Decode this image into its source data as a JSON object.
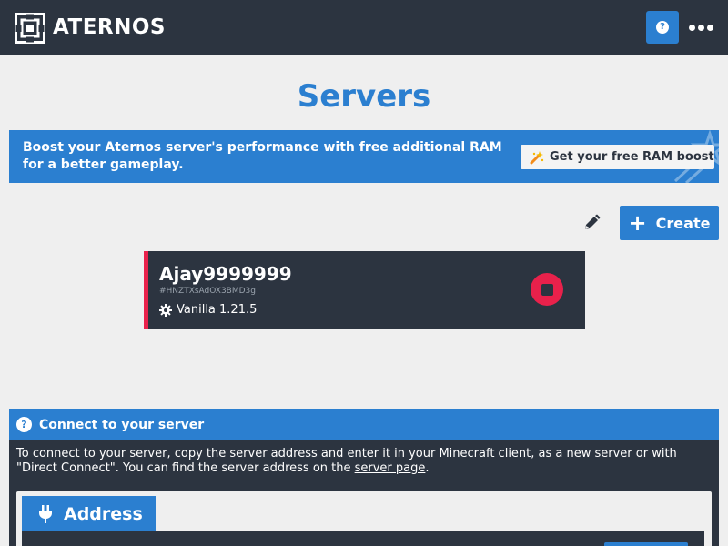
{
  "header": {
    "brand": "ATERNOS",
    "logo_icon": "aternos-logo-icon",
    "help_icon": "question-circle-icon",
    "more_icon": "ellipsis-icon"
  },
  "page": {
    "title": "Servers"
  },
  "boost": {
    "text": "Boost your Aternos server's performance with free additional RAM for a better gameplay.",
    "button_label": "Get your free RAM boost",
    "button_icon": "magic-wand-icon"
  },
  "toolbar": {
    "edit_icon": "pencil-icon",
    "create_label": "Create",
    "create_icon": "plus-icon"
  },
  "server": {
    "name": "Ajay9999999",
    "id": "#HNZTXsAdOX3BMD3g",
    "software": "Vanilla 1.21.5",
    "software_icon": "gear-icon",
    "status_icon": "stop-icon"
  },
  "connect": {
    "title": "Connect to your server",
    "title_icon": "question-circle-icon",
    "text_before": "To connect to your server, copy the server address and enter it in your Minecraft client, as a new server or with \"Direct Connect\". You can find the server address on the ",
    "link_text": "server page",
    "text_after": ".",
    "address_tab_label": "Address",
    "address_tab_icon": "plug-icon"
  },
  "colors": {
    "header_bg": "#2c3440",
    "accent": "#2b7fd0",
    "offline": "#e9214b",
    "page_bg": "#efefef"
  }
}
